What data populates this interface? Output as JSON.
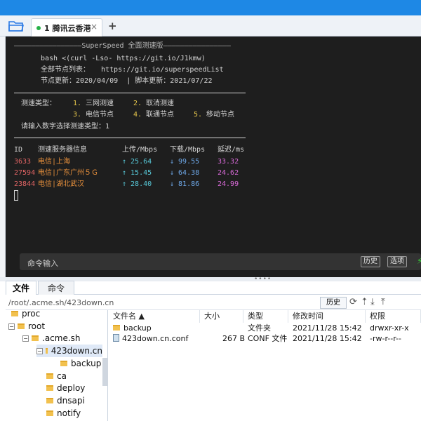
{
  "tab": {
    "label": "1 腾讯云香港",
    "close": "×",
    "add": "+"
  },
  "terminal": {
    "header_rule": "————————————————SuperSpeed 全面测速版————————————————",
    "cmd_line": "bash <(curl -Lso- https://git.io/J1kmw)",
    "node_list_label": "全部节点列表：",
    "node_list_url": "https://git.io/superspeedList",
    "node_update": "节点更新：2020/04/09  | 脚本更新：2021/07/22",
    "menu_title": "测速类型：",
    "menu": [
      {
        "num": "1.",
        "label": "三网测速"
      },
      {
        "num": "2.",
        "label": "取消测速"
      },
      {
        "num": "3.",
        "label": "电信节点"
      },
      {
        "num": "4.",
        "label": "联通节点"
      },
      {
        "num": "5.",
        "label": "移动节点"
      }
    ],
    "prompt": "请输入数字选择测速类型：1",
    "table_headers": {
      "id": "ID",
      "server": "测速服务器信息",
      "up": "上传/Mbps",
      "down": "下载/Mbps",
      "latency": "延迟/ms"
    },
    "rows": [
      {
        "id": "3633",
        "server": "电信|上海",
        "up": "↑ 25.64",
        "down": "↓ 99.55",
        "latency": "33.32"
      },
      {
        "id": "27594",
        "server": "电信|广东广州５Ｇ",
        "up": "↑ 15.45",
        "down": "↓ 64.38",
        "latency": "24.62"
      },
      {
        "id": "23844",
        "server": "电信|湖北武汉",
        "up": "↑ 28.40",
        "down": "↓ 81.86",
        "latency": "24.99"
      }
    ]
  },
  "cmdbar": {
    "placeholder": "命令输入",
    "history": "历史",
    "options": "选项"
  },
  "lower_tabs": {
    "files": "文件",
    "commands": "命令"
  },
  "pathbar": {
    "path": "/root/.acme.sh/423down.cn",
    "history": "历史"
  },
  "tree": {
    "items": [
      {
        "label": "proc",
        "toggle": ""
      },
      {
        "label": "root",
        "toggle": "−"
      },
      {
        "label": ".acme.sh",
        "toggle": "−"
      },
      {
        "label": "423down.cn",
        "toggle": "−"
      },
      {
        "label": "backup",
        "toggle": ""
      },
      {
        "label": "ca",
        "toggle": ""
      },
      {
        "label": "deploy",
        "toggle": ""
      },
      {
        "label": "dnsapi",
        "toggle": ""
      },
      {
        "label": "notify",
        "toggle": ""
      }
    ]
  },
  "filelist": {
    "headers": {
      "name": "文件名 ▲",
      "size": "大小",
      "type": "类型",
      "mtime": "修改时间",
      "perm": "权限"
    },
    "rows": [
      {
        "name": "backup",
        "size": "",
        "type": "文件夹",
        "mtime": "2021/11/28 15:42",
        "perm": "drwxr-xr-x"
      },
      {
        "name": "423down.cn.conf",
        "size": "267 B",
        "type": "CONF 文件",
        "mtime": "2021/11/28 15:42",
        "perm": "-rw-r--r--"
      }
    ]
  },
  "colors": {
    "accent": "#1e88e5",
    "terminal_bg": "#1e1e1e",
    "cmdbar_bg": "#333333"
  }
}
